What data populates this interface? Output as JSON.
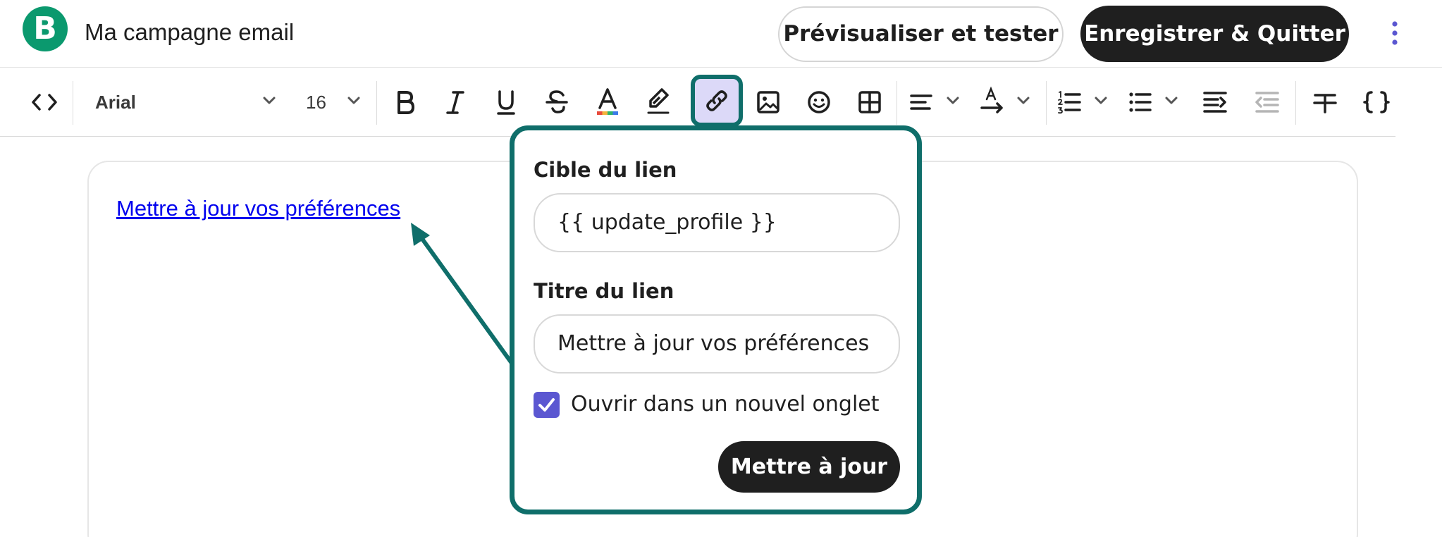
{
  "header": {
    "logo_letter": "B",
    "campaign_title": "Ma campagne email",
    "preview_button": "Prévisualiser et tester",
    "save_button": "Enregistrer & Quitter"
  },
  "toolbar": {
    "font_family": "Arial",
    "font_size": "16",
    "active_tool": "link"
  },
  "editor": {
    "link_text": "Mettre à jour vos préférences"
  },
  "link_popover": {
    "target_label": "Cible du lien",
    "target_value": "{{ update_profile }}",
    "title_label": "Titre du lien",
    "title_value": "Mettre à jour vos préférences",
    "new_tab_label": "Ouvrir dans un nouvel onglet",
    "new_tab_checked": true,
    "update_button": "Mettre à jour"
  },
  "colors": {
    "brand_green": "#0b996e",
    "annotation_teal": "#0f6e6a",
    "checkbox_purple": "#5b57d1",
    "active_tool_bg": "#dcd9f8",
    "link_blue": "#0000ee"
  }
}
